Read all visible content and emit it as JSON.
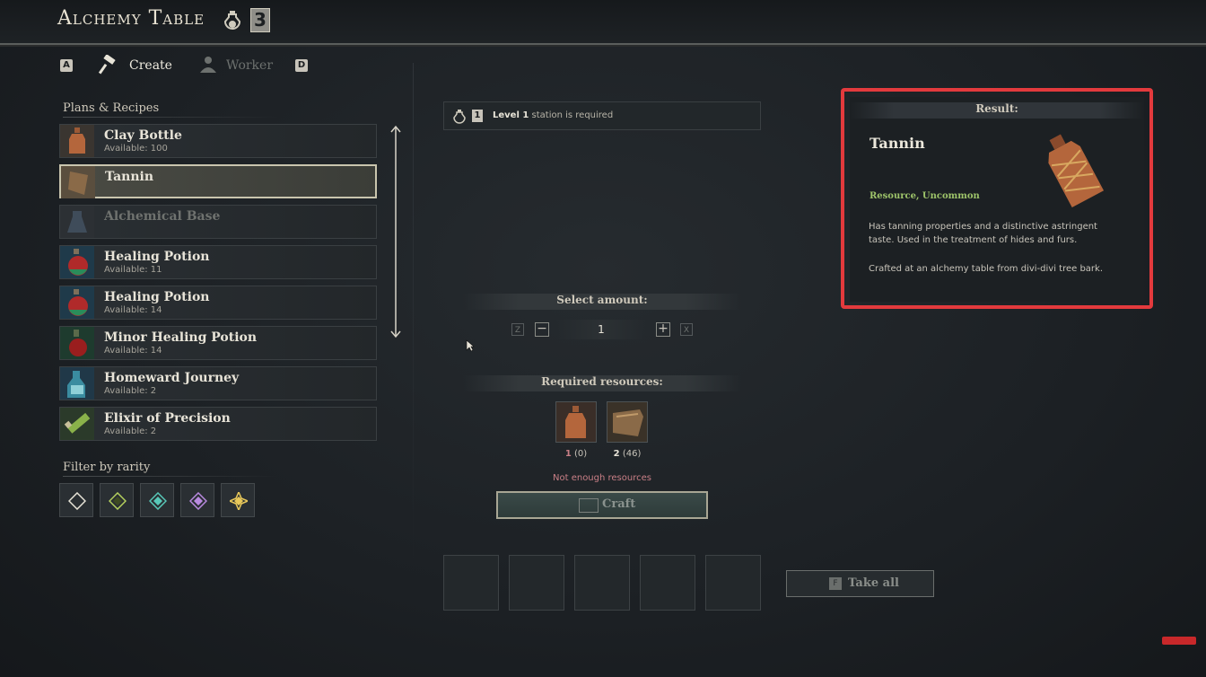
{
  "header": {
    "title": "Alchemy Table",
    "station_level": "3"
  },
  "tabs": {
    "prev_key": "A",
    "next_key": "D",
    "create_label": "Create",
    "worker_label": "Worker"
  },
  "recipes": {
    "section_title": "Plans & Recipes",
    "items": [
      {
        "name": "Clay Bottle",
        "available": "Available: 100",
        "icon": "clay-bottle-icon"
      },
      {
        "name": "Tannin",
        "available": "",
        "icon": "tannin-icon",
        "selected": true
      },
      {
        "name": "Alchemical Base",
        "available": "",
        "icon": "alchemical-base-icon",
        "disabled": true
      },
      {
        "name": "Healing Potion",
        "available": "Available: 11",
        "icon": "healing-potion-icon"
      },
      {
        "name": "Healing Potion",
        "available": "Available: 14",
        "icon": "healing-potion-icon"
      },
      {
        "name": "Minor Healing Potion",
        "available": "Available: 14",
        "icon": "minor-healing-potion-icon"
      },
      {
        "name": "Homeward Journey",
        "available": "Available: 2",
        "icon": "homeward-journey-icon"
      },
      {
        "name": "Elixir of Precision",
        "available": "Available: 2",
        "icon": "elixir-icon"
      }
    ]
  },
  "filter": {
    "title": "Filter by rarity",
    "colors": [
      "#e8e4d8",
      "#b6d25e",
      "#58c8b8",
      "#b98ae0",
      "#e8c85a"
    ]
  },
  "requirement": {
    "level": "Level 1",
    "text": "station is required"
  },
  "amount": {
    "label": "Select amount:",
    "value": "1",
    "dec_key": "Z",
    "inc_key": "X"
  },
  "resources": {
    "label": "Required resources:",
    "items": [
      {
        "have": "1",
        "need": "(0)",
        "icon": "clay-bottle-icon"
      },
      {
        "have": "2",
        "need": "(46)",
        "icon": "divi-bark-icon"
      }
    ],
    "warning": "Not enough resources"
  },
  "craft": {
    "label": "Craft"
  },
  "take_all": {
    "key": "F",
    "label": "Take all"
  },
  "result": {
    "header": "Result:",
    "name": "Tannin",
    "category": "Resource, Uncommon",
    "desc1": "Has tanning properties and a distinctive astringent taste. Used in the treatment of hides and furs.",
    "desc2": "Crafted at an alchemy table from divi-divi tree bark."
  },
  "colors": {
    "accent_green": "#9ec46a",
    "warning": "#c97f86",
    "highlight_red": "#e33a3d"
  }
}
